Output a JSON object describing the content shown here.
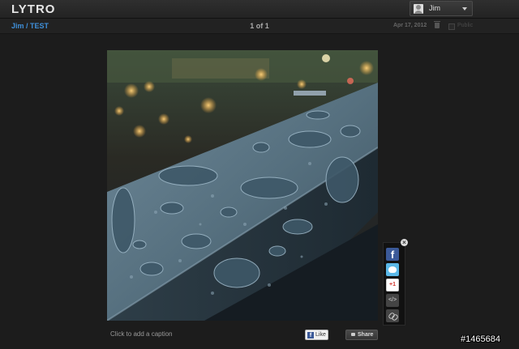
{
  "header": {
    "logo": "LYTRO",
    "user": {
      "name": "Jim"
    }
  },
  "subheader": {
    "breadcrumb": "Jim / TEST",
    "counter": "1 of 1",
    "date": "Apr 17, 2012",
    "public_label": "Public"
  },
  "photo": {
    "subject": "water droplets on railing, city lights bokeh"
  },
  "footer": {
    "caption_placeholder": "Click to add a caption",
    "like_label": "Like",
    "share_label": "Share"
  },
  "share_panel": {
    "icons": [
      "facebook-icon",
      "twitter-icon",
      "google-plus-icon",
      "embed-icon",
      "link-icon"
    ],
    "gplus_label": "+1",
    "embed_label": "</>"
  },
  "watermark": "#1465684",
  "colors": {
    "background": "#1c1c1c",
    "accent": "#3f8fd9",
    "facebook": "#3b5998"
  }
}
